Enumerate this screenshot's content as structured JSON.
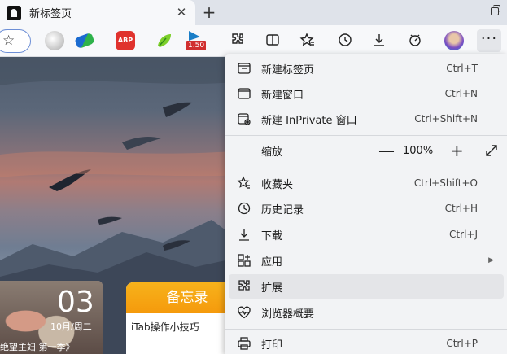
{
  "tab": {
    "title": "新标签页",
    "close": "✕",
    "new_tab": "+"
  },
  "toolbar": {
    "extensions": [
      {
        "name": "extension-1",
        "label": ""
      },
      {
        "name": "extension-2",
        "label": ""
      },
      {
        "name": "adblock-plus",
        "label": "ABP"
      },
      {
        "name": "extension-4",
        "label": ""
      },
      {
        "name": "extension-5",
        "badge": "1.50"
      }
    ],
    "icons": [
      "split-screen-icon",
      "favorites-icon",
      "history-icon",
      "downloads-icon",
      "performance-icon"
    ]
  },
  "menu": {
    "items": [
      {
        "id": "new-tab",
        "label": "新建标签页",
        "shortcut": "Ctrl+T",
        "icon": "new-tab-icon"
      },
      {
        "id": "new-window",
        "label": "新建窗口",
        "shortcut": "Ctrl+N",
        "icon": "new-window-icon"
      },
      {
        "id": "new-inprivate",
        "label": "新建 InPrivate 窗口",
        "shortcut": "Ctrl+Shift+N",
        "icon": "inprivate-icon"
      },
      {
        "id": "favorites",
        "label": "收藏夹",
        "shortcut": "Ctrl+Shift+O",
        "icon": "favorites-icon"
      },
      {
        "id": "history",
        "label": "历史记录",
        "shortcut": "Ctrl+H",
        "icon": "history-icon"
      },
      {
        "id": "downloads",
        "label": "下载",
        "shortcut": "Ctrl+J",
        "icon": "download-icon"
      },
      {
        "id": "apps",
        "label": "应用",
        "shortcut": "",
        "icon": "apps-icon",
        "submenu": true
      },
      {
        "id": "extensions",
        "label": "扩展",
        "shortcut": "",
        "icon": "extensions-icon",
        "hovered": true
      },
      {
        "id": "essentials",
        "label": "浏览器概要",
        "shortcut": "",
        "icon": "heartbeat-icon"
      },
      {
        "id": "print",
        "label": "打印",
        "shortcut": "Ctrl+P",
        "icon": "print-icon"
      }
    ],
    "zoom": {
      "label": "缩放",
      "minus": "—",
      "value": "100%",
      "plus": "+"
    }
  },
  "page": {
    "date_card": {
      "day": "03",
      "month_dow": "10月/周二",
      "show_title": "绝望主妇 第一季》"
    },
    "memo_card": {
      "title": "备忘录",
      "item": "iTab操作小技巧"
    }
  }
}
